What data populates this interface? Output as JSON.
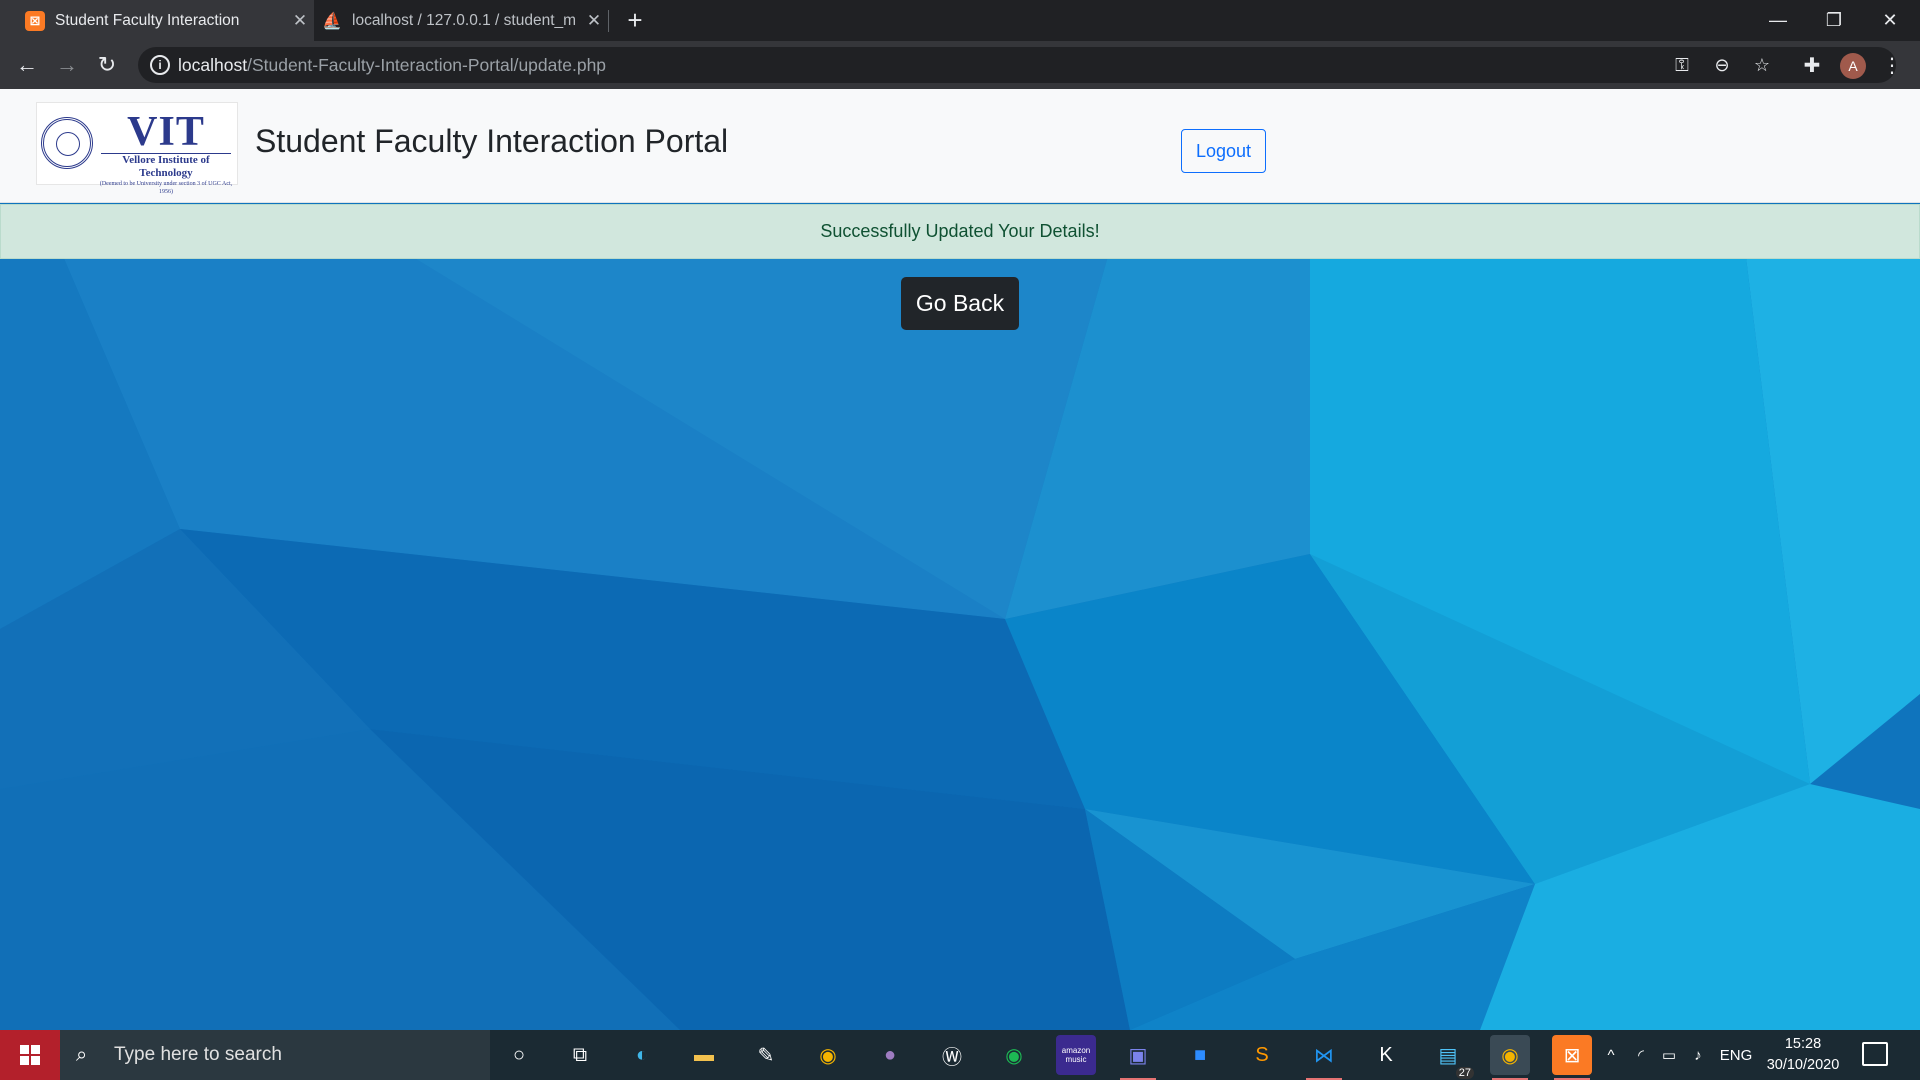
{
  "browser": {
    "tabs": [
      {
        "title": "Student Faculty Interaction",
        "favicon": "xampp-icon",
        "active": true
      },
      {
        "title": "localhost / 127.0.0.1 / student_m",
        "favicon": "phpmyadmin-icon",
        "active": false
      }
    ],
    "url_host": "localhost",
    "url_path": "/Student-Faculty-Interaction-Portal/update.php",
    "profile_initial": "A"
  },
  "header": {
    "logo_text": "VIT",
    "logo_subtitle": "Vellore Institute of Technology",
    "logo_tagline": "(Deemed to be University under section 3 of UGC Act, 1956)",
    "title": "Student Faculty Interaction Portal",
    "logout_label": "Logout"
  },
  "alert": {
    "message": "Successfully Updated Your Details!",
    "color": "#d1e7dd"
  },
  "main": {
    "go_back_label": "Go Back"
  },
  "taskbar": {
    "search_placeholder": "Type here to search",
    "apps": [
      "cortana-icon",
      "task-view-icon",
      "edge-icon",
      "file-explorer-icon",
      "paint-icon",
      "chrome-icon",
      "github-icon",
      "word-icon",
      "spotify-icon",
      "amazon-music-icon",
      "teams-icon",
      "zoom-icon",
      "sublime-icon",
      "vscode-icon",
      "kite-icon",
      "notepad-icon",
      "chrome-profile-icon",
      "xampp-icon"
    ],
    "badge_count": "27",
    "amazon_label": "amazon music",
    "language": "ENG",
    "time": "15:28",
    "date": "30/10/2020"
  }
}
